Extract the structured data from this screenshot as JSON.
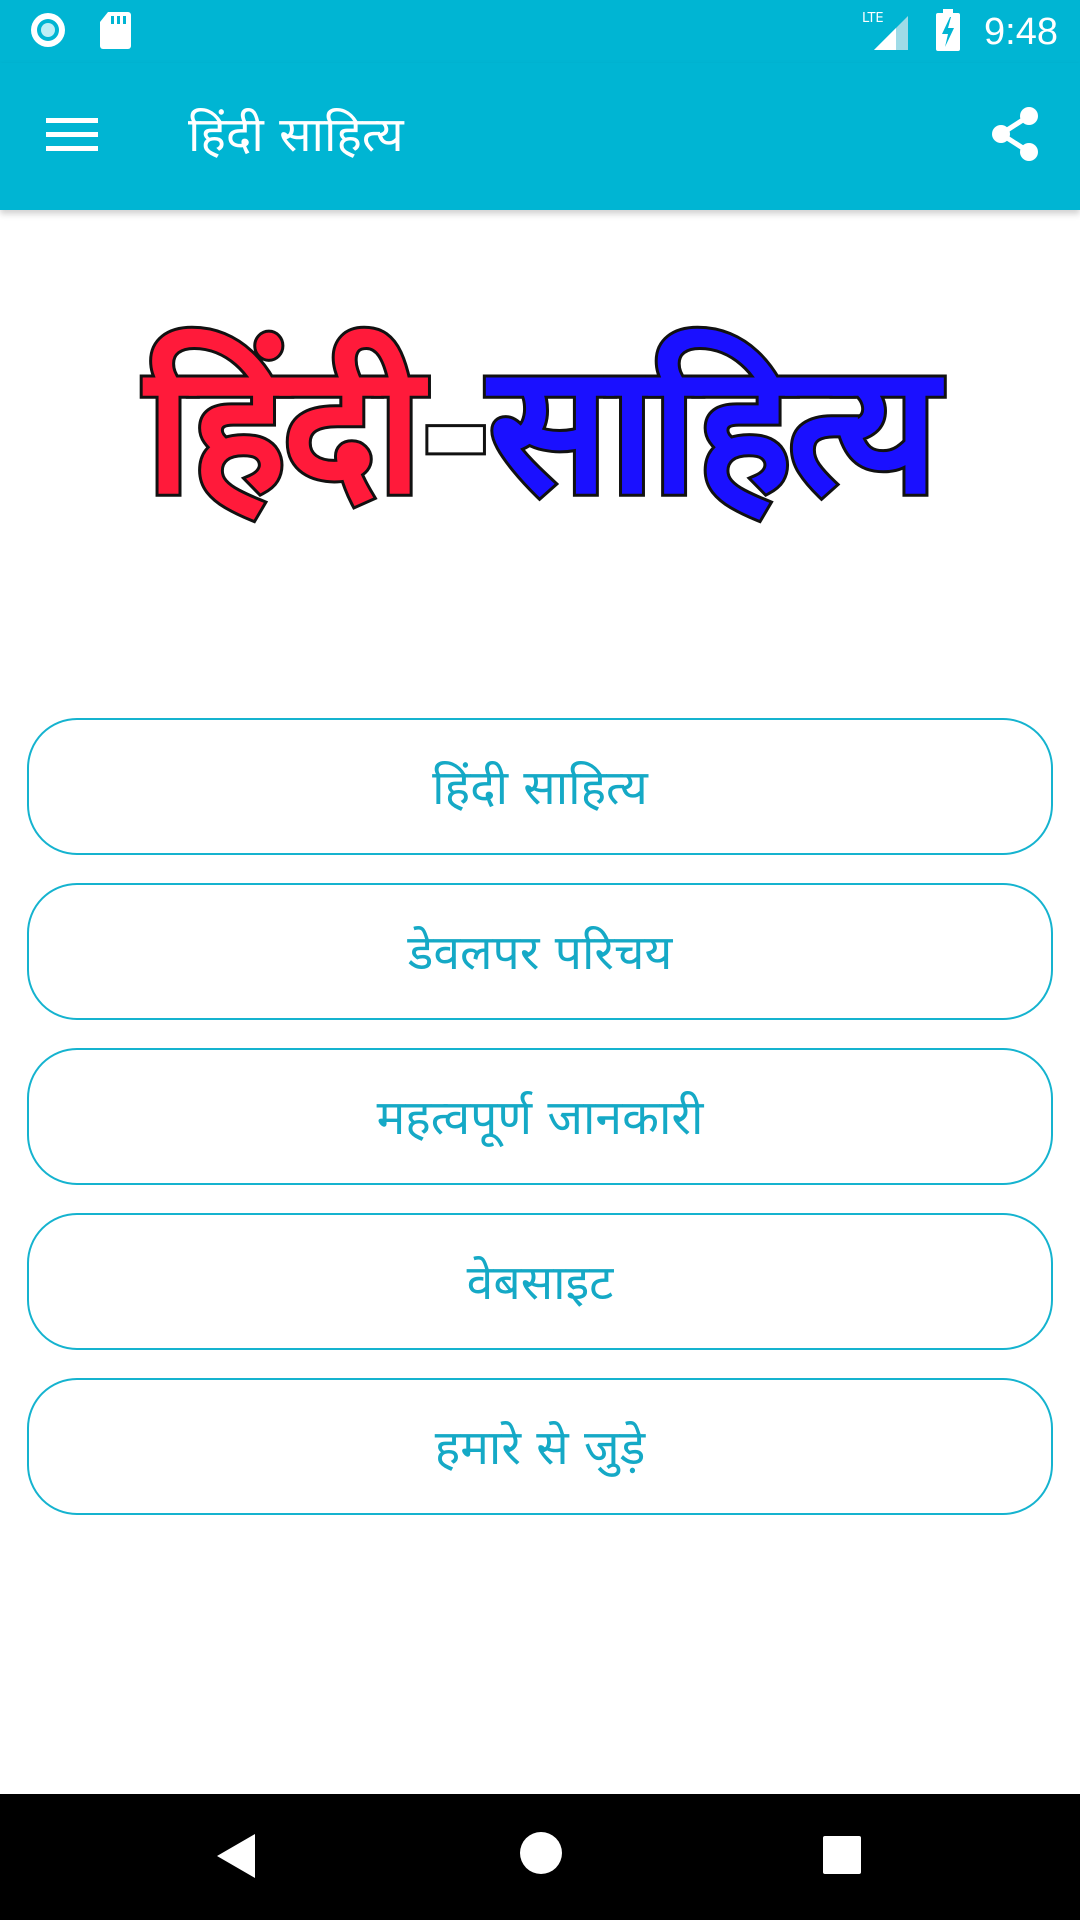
{
  "status_bar": {
    "time": "9:48",
    "network": "LTE",
    "left_icons": [
      "sync-icon",
      "sd-card-icon"
    ],
    "right_icons": [
      "lte-signal-icon",
      "battery-charging-icon"
    ]
  },
  "app_bar": {
    "title": "हिंदी साहित्य",
    "menu_icon": "hamburger-icon",
    "share_icon": "share-icon"
  },
  "logo": {
    "part1": "हिंदी",
    "dash": "-",
    "part2": "साहित्य",
    "colors": {
      "part1": "#ff1a3a",
      "part2": "#1a10ff"
    }
  },
  "menu": {
    "items": [
      {
        "label": "हिंदी साहित्य"
      },
      {
        "label": "डेवलपर परिचय"
      },
      {
        "label": "महत्वपूर्ण जानकारी"
      },
      {
        "label": "वेबसाइट"
      },
      {
        "label": "हमारे से जुड़े"
      }
    ]
  },
  "nav_bar": {
    "icons": [
      "back-icon",
      "home-icon",
      "recents-icon"
    ]
  },
  "colors": {
    "primary": "#00b5d3",
    "button_border": "#15b3cf",
    "button_text": "#15a9c6"
  }
}
